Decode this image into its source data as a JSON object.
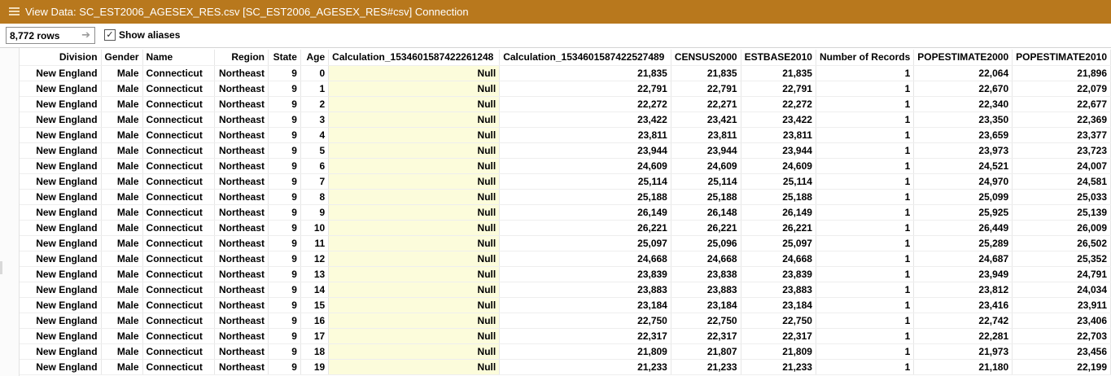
{
  "window": {
    "title": "View Data:  SC_EST2006_AGESEX_RES.csv [SC_EST2006_AGESEX_RES#csv] Connection",
    "icon": "table-view-icon"
  },
  "toolbar": {
    "row_count": "8,772 rows",
    "row_count_arrow": "➔",
    "show_aliases_label": "Show aliases",
    "show_aliases_checked": true,
    "checkmark": "✓"
  },
  "colors": {
    "titlebar": "#b8781d",
    "highlight_column": "#fcfcdb"
  },
  "table": {
    "columns": [
      "Division",
      "Gender",
      "Name",
      "Region",
      "State",
      "Age",
      "Calculation_1534601587422261248",
      "Calculation_1534601587422527489",
      "CENSUS2000",
      "ESTBASE2010",
      "Number of Records",
      "POPESTIMATE2000",
      "POPESTIMATE2010"
    ],
    "rows": [
      [
        "New England",
        "Male",
        "Connecticut",
        "Northeast",
        "9",
        "0",
        "Null",
        "21,835",
        "21,835",
        "21,835",
        "1",
        "22,064",
        "21,896"
      ],
      [
        "New England",
        "Male",
        "Connecticut",
        "Northeast",
        "9",
        "1",
        "Null",
        "22,791",
        "22,791",
        "22,791",
        "1",
        "22,670",
        "22,079"
      ],
      [
        "New England",
        "Male",
        "Connecticut",
        "Northeast",
        "9",
        "2",
        "Null",
        "22,272",
        "22,271",
        "22,272",
        "1",
        "22,340",
        "22,677"
      ],
      [
        "New England",
        "Male",
        "Connecticut",
        "Northeast",
        "9",
        "3",
        "Null",
        "23,422",
        "23,421",
        "23,422",
        "1",
        "23,350",
        "22,369"
      ],
      [
        "New England",
        "Male",
        "Connecticut",
        "Northeast",
        "9",
        "4",
        "Null",
        "23,811",
        "23,811",
        "23,811",
        "1",
        "23,659",
        "23,377"
      ],
      [
        "New England",
        "Male",
        "Connecticut",
        "Northeast",
        "9",
        "5",
        "Null",
        "23,944",
        "23,944",
        "23,944",
        "1",
        "23,973",
        "23,723"
      ],
      [
        "New England",
        "Male",
        "Connecticut",
        "Northeast",
        "9",
        "6",
        "Null",
        "24,609",
        "24,609",
        "24,609",
        "1",
        "24,521",
        "24,007"
      ],
      [
        "New England",
        "Male",
        "Connecticut",
        "Northeast",
        "9",
        "7",
        "Null",
        "25,114",
        "25,114",
        "25,114",
        "1",
        "24,970",
        "24,581"
      ],
      [
        "New England",
        "Male",
        "Connecticut",
        "Northeast",
        "9",
        "8",
        "Null",
        "25,188",
        "25,188",
        "25,188",
        "1",
        "25,099",
        "25,033"
      ],
      [
        "New England",
        "Male",
        "Connecticut",
        "Northeast",
        "9",
        "9",
        "Null",
        "26,149",
        "26,148",
        "26,149",
        "1",
        "25,925",
        "25,139"
      ],
      [
        "New England",
        "Male",
        "Connecticut",
        "Northeast",
        "9",
        "10",
        "Null",
        "26,221",
        "26,221",
        "26,221",
        "1",
        "26,449",
        "26,009"
      ],
      [
        "New England",
        "Male",
        "Connecticut",
        "Northeast",
        "9",
        "11",
        "Null",
        "25,097",
        "25,096",
        "25,097",
        "1",
        "25,289",
        "26,502"
      ],
      [
        "New England",
        "Male",
        "Connecticut",
        "Northeast",
        "9",
        "12",
        "Null",
        "24,668",
        "24,668",
        "24,668",
        "1",
        "24,687",
        "25,352"
      ],
      [
        "New England",
        "Male",
        "Connecticut",
        "Northeast",
        "9",
        "13",
        "Null",
        "23,839",
        "23,838",
        "23,839",
        "1",
        "23,949",
        "24,791"
      ],
      [
        "New England",
        "Male",
        "Connecticut",
        "Northeast",
        "9",
        "14",
        "Null",
        "23,883",
        "23,883",
        "23,883",
        "1",
        "23,812",
        "24,034"
      ],
      [
        "New England",
        "Male",
        "Connecticut",
        "Northeast",
        "9",
        "15",
        "Null",
        "23,184",
        "23,184",
        "23,184",
        "1",
        "23,416",
        "23,911"
      ],
      [
        "New England",
        "Male",
        "Connecticut",
        "Northeast",
        "9",
        "16",
        "Null",
        "22,750",
        "22,750",
        "22,750",
        "1",
        "22,742",
        "23,406"
      ],
      [
        "New England",
        "Male",
        "Connecticut",
        "Northeast",
        "9",
        "17",
        "Null",
        "22,317",
        "22,317",
        "22,317",
        "1",
        "22,281",
        "22,703"
      ],
      [
        "New England",
        "Male",
        "Connecticut",
        "Northeast",
        "9",
        "18",
        "Null",
        "21,809",
        "21,807",
        "21,809",
        "1",
        "21,973",
        "23,456"
      ],
      [
        "New England",
        "Male",
        "Connecticut",
        "Northeast",
        "9",
        "19",
        "Null",
        "21,233",
        "21,233",
        "21,233",
        "1",
        "21,180",
        "22,199"
      ]
    ]
  }
}
